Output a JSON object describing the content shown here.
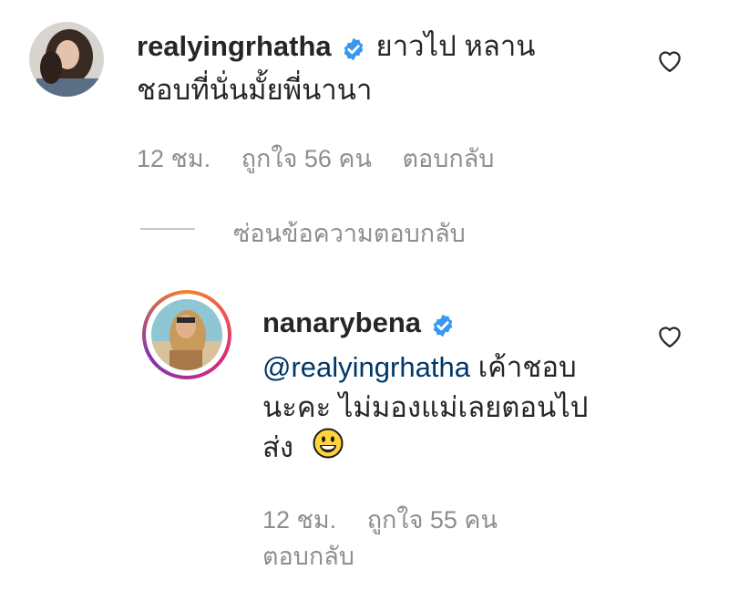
{
  "comment": {
    "username": "realyingrhatha",
    "text_line1": "ยาวไป หลาน",
    "text_line2": "ชอบที่นั่นมั้ยพี่นานา",
    "time": "12 ชม.",
    "likes": "ถูกใจ 56 คน",
    "reply_label": "ตอบกลับ"
  },
  "hide_replies_label": "ซ่อนข้อความตอบกลับ",
  "reply": {
    "username": "nanarybena",
    "mention": "@realyingrhatha",
    "text_line1_rest": "เค้าชอบ",
    "text_line2": "นะคะ ไม่มองแม่เลยตอนไป",
    "text_line3": "ส่ง",
    "time": "12 ชม.",
    "likes": "ถูกใจ 55 คน",
    "reply_label": "ตอบกลับ"
  },
  "icons": {
    "verified": "verified-badge-icon",
    "like": "heart-icon",
    "emoji": "grinning-face-emoji"
  },
  "colors": {
    "verified_blue": "#3897f0",
    "mention_blue": "#00376b",
    "meta_gray": "#8e8e8e",
    "story_ring": [
      "#f58529",
      "#dd2a7b",
      "#8134af"
    ]
  }
}
